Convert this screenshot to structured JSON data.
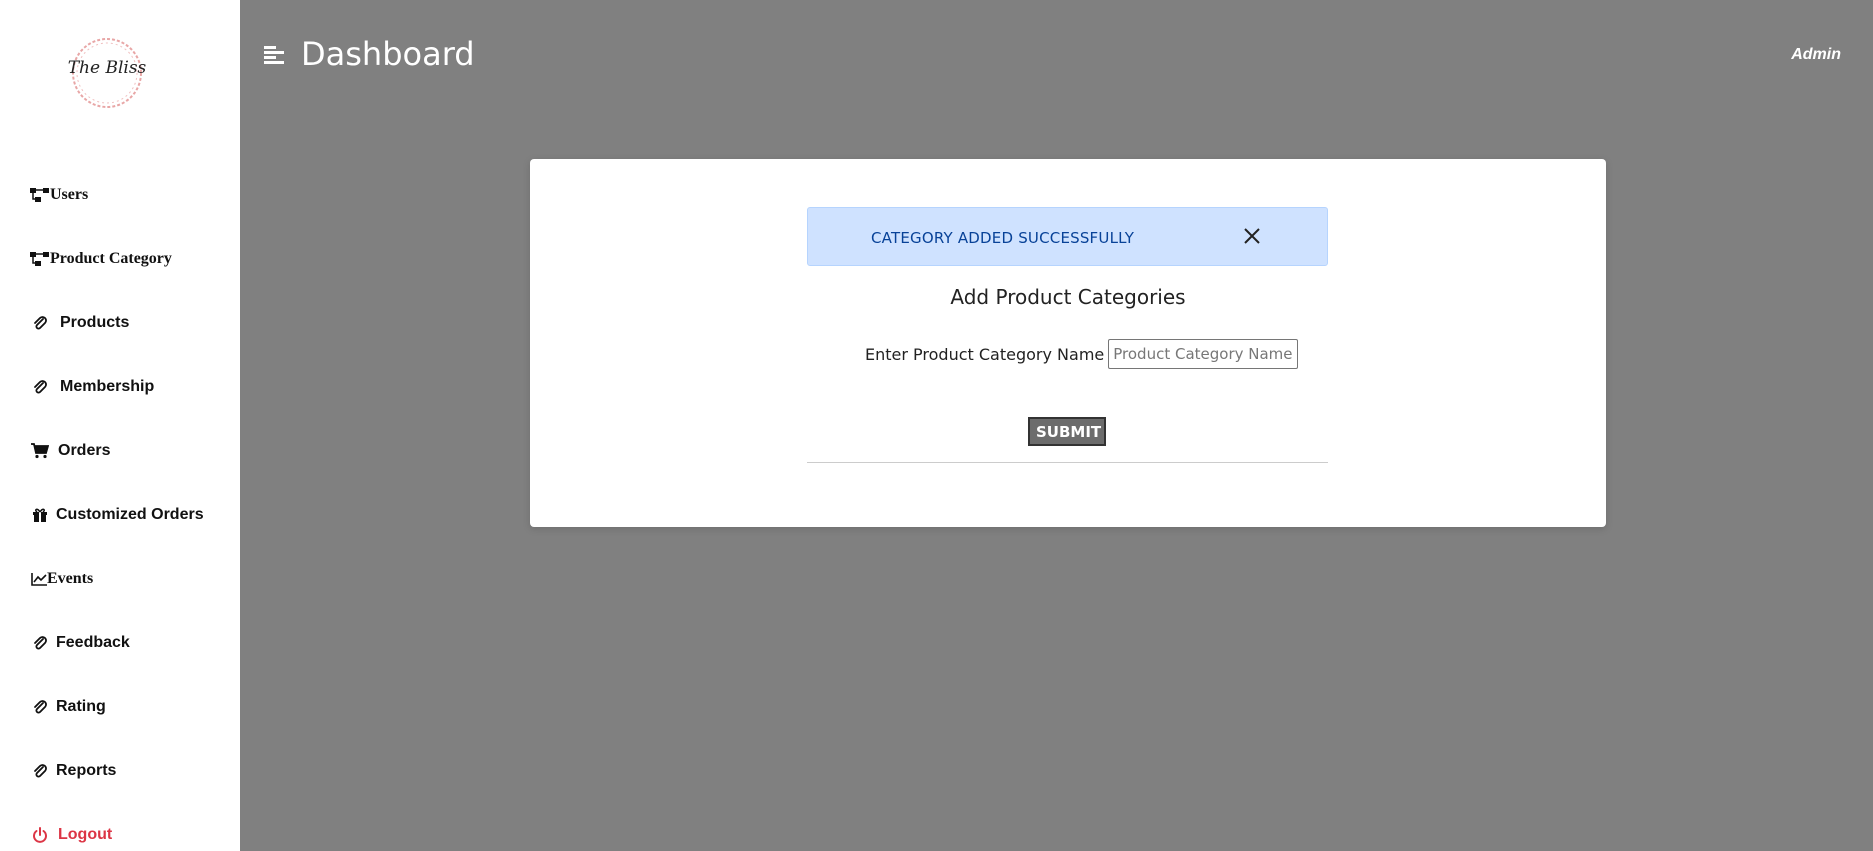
{
  "brand": {
    "logo_text": "The Bliss"
  },
  "sidebar": {
    "items": [
      {
        "label": "Users",
        "icon": "sitemap-icon"
      },
      {
        "label": "Product Category",
        "icon": "sitemap-icon"
      },
      {
        "label": "Products",
        "icon": "paperclip-icon"
      },
      {
        "label": "Membership",
        "icon": "paperclip-icon"
      },
      {
        "label": "Orders",
        "icon": "cart-icon"
      },
      {
        "label": "Customized Orders",
        "icon": "gift-icon"
      },
      {
        "label": "Events",
        "icon": "chart-line-icon"
      },
      {
        "label": "Feedback",
        "icon": "paperclip-icon"
      },
      {
        "label": "Rating",
        "icon": "paperclip-icon"
      },
      {
        "label": "Reports",
        "icon": "paperclip-icon"
      },
      {
        "label": "Logout",
        "icon": "power-icon"
      }
    ]
  },
  "header": {
    "title": "Dashboard",
    "user": "Admin"
  },
  "modal": {
    "alert_text": "CATEGORY ADDED SUCCESSFULLY",
    "form_title": "Add Product Categories",
    "field_label": "Enter Product Category Name",
    "field_placeholder": "Product Category Name",
    "field_value": "",
    "submit_label": "SUBMIT"
  },
  "colors": {
    "overlay": "#808080",
    "alert_bg": "#cfe2ff",
    "alert_text": "#084298",
    "logout": "#dc3545"
  }
}
